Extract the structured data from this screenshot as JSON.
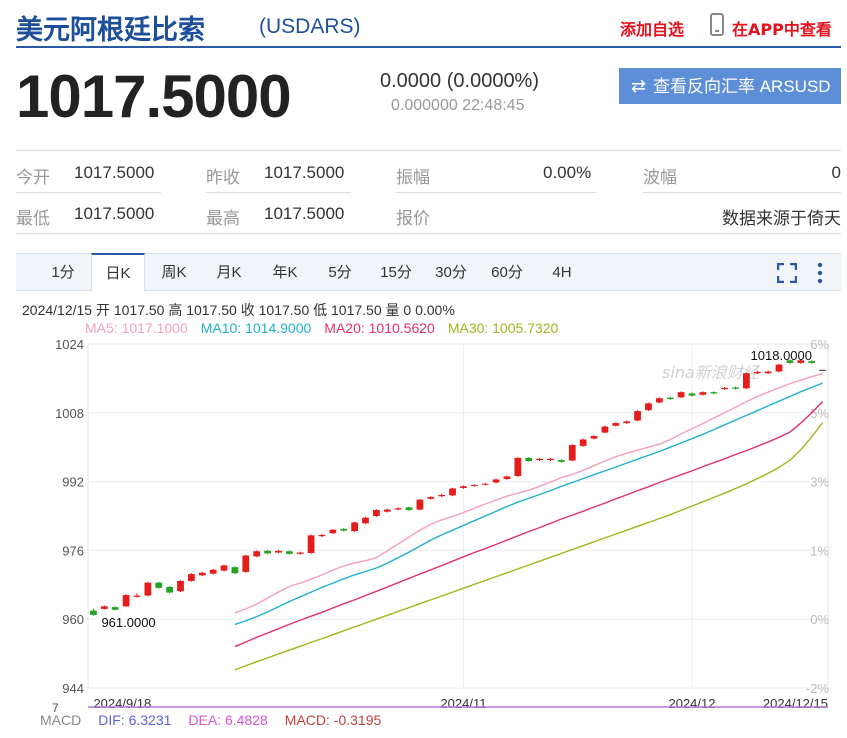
{
  "header": {
    "name": "美元阿根廷比索",
    "code": "(USDARS)",
    "add_watchlist": "添加自选",
    "view_in_app": "在APP中查看"
  },
  "quote": {
    "price": "1017.5000",
    "change": "0.0000 (0.0000%)",
    "timestamp": "0.000000 22:48:45",
    "reverse_button": "查看反向汇率 ARSUSD",
    "reverse_icon": "swap-arrows-icon"
  },
  "stats": {
    "open_label": "今开",
    "open": "1017.5000",
    "prev_close_label": "昨收",
    "prev_close": "1017.5000",
    "amplitude_label": "振幅",
    "amplitude": "0.00%",
    "wave_label": "波幅",
    "wave": "0",
    "low_label": "最低",
    "low": "1017.5000",
    "high_label": "最高",
    "high": "1017.5000",
    "quote_label": "报价",
    "source": "数据来源于倚天"
  },
  "tabs": [
    "1分",
    "日K",
    "周K",
    "月K",
    "年K",
    "5分",
    "15分",
    "30分",
    "60分",
    "4H"
  ],
  "active_tab": "日K",
  "ohlc_line": "2024/12/15 开 1017.50 高 1017.50 收 1017.50 低 1017.50 量 0 0.00%",
  "ma_line": {
    "ma5": "MA5: 1017.1000",
    "ma10": "MA10: 1014.9000",
    "ma20": "MA20: 1010.5620",
    "ma30": "MA30: 1005.7320"
  },
  "macd_line": {
    "label": "MACD",
    "dif": "DIF: 6.3231",
    "dea": "DEA: 6.4828",
    "macd": "MACD: -0.3195"
  },
  "colors": {
    "up": "#e41c1c",
    "down": "#21a321",
    "ma5": "#f4a0b8",
    "ma10": "#1fb0cf",
    "ma20": "#e4306c",
    "ma30": "#99b81c",
    "brand": "#1e4f9c",
    "accent_red": "#e4121e"
  },
  "chart_data": {
    "type": "candlestick",
    "y_ticks": [
      "1024",
      "1008",
      "992",
      "976",
      "960",
      "944"
    ],
    "ylim": [
      944,
      1024
    ],
    "pct_ticks": [
      "6%",
      "5%",
      "3%",
      "1%",
      "0%",
      "-2%"
    ],
    "x_ticks": [
      "2024/9/18",
      "2024/11",
      "2024/12",
      "2024/12/15"
    ],
    "max_label": "1018.0000",
    "min_label": "961.0000",
    "watermark": "sina新浪财经",
    "series": [
      {
        "name": "MA5",
        "values": [
          961.5,
          962.4,
          963.5,
          964.9,
          966.3,
          967.6,
          968.4,
          969.3,
          970.3,
          971.4,
          972.4,
          973.1,
          973.6,
          974.3,
          975.9,
          977.5,
          979.1,
          980.7,
          982.1,
          983.1,
          983.9,
          984.8,
          985.8,
          986.8,
          987.7,
          988.6,
          989.3,
          990.0,
          990.9,
          991.9,
          992.9,
          993.7,
          994.6,
          995.7,
          996.8,
          997.8,
          998.6,
          999.3,
          1000.0,
          1000.7,
          1001.8,
          1003.1,
          1004.3,
          1005.5,
          1006.8,
          1008.0,
          1009.3,
          1010.6,
          1011.8,
          1012.8,
          1013.8,
          1014.8,
          1015.6,
          1016.4,
          1017.1
        ]
      },
      {
        "name": "MA10",
        "values": [
          958.8,
          959.6,
          960.6,
          961.7,
          962.9,
          964.1,
          965.2,
          966.3,
          967.4,
          968.4,
          969.4,
          970.3,
          971.1,
          971.9,
          973.0,
          974.3,
          975.6,
          977.0,
          978.4,
          979.6,
          980.7,
          981.8,
          982.9,
          984.0,
          985.1,
          986.2,
          987.2,
          988.1,
          989.0,
          989.9,
          990.9,
          991.8,
          992.7,
          993.6,
          994.5,
          995.4,
          996.3,
          997.2,
          998.1,
          999.0,
          1000.0,
          1001.0,
          1002.0,
          1003.0,
          1004.1,
          1005.2,
          1006.3,
          1007.4,
          1008.5,
          1009.6,
          1010.7,
          1011.8,
          1012.9,
          1013.9,
          1014.9
        ]
      },
      {
        "name": "MA20",
        "values": [
          953.6,
          954.7,
          955.8,
          956.8,
          957.8,
          958.8,
          959.8,
          960.7,
          961.6,
          962.6,
          963.6,
          964.5,
          965.5,
          966.5,
          967.5,
          968.5,
          969.5,
          970.5,
          971.5,
          972.5,
          973.5,
          974.5,
          975.5,
          976.4,
          977.4,
          978.4,
          979.4,
          980.4,
          981.3,
          982.3,
          983.3,
          984.2,
          985.1,
          986.1,
          987.0,
          988.0,
          988.9,
          989.9,
          990.8,
          991.8,
          992.7,
          993.6,
          994.5,
          995.5,
          996.4,
          997.3,
          998.3,
          999.2,
          1000.2,
          1001.2,
          1002.3,
          1003.5,
          1005.6,
          1008.0,
          1010.6
        ]
      },
      {
        "name": "MA30",
        "values": [
          948.2,
          949.2,
          950.1,
          951.0,
          951.9,
          952.8,
          953.7,
          954.6,
          955.5,
          956.4,
          957.3,
          958.2,
          959.1,
          960.0,
          960.9,
          961.8,
          962.7,
          963.6,
          964.5,
          965.4,
          966.3,
          967.2,
          968.1,
          969.0,
          969.9,
          970.8,
          971.7,
          972.6,
          973.5,
          974.4,
          975.3,
          976.2,
          977.1,
          978.0,
          978.9,
          979.8,
          980.7,
          981.6,
          982.5,
          983.4,
          984.3,
          985.3,
          986.3,
          987.3,
          988.3,
          989.3,
          990.4,
          991.5,
          992.7,
          993.9,
          995.3,
          997.0,
          999.4,
          1002.4,
          1005.7
        ]
      }
    ],
    "candles": [
      {
        "o": 962.0,
        "c": 961.0,
        "h": 962.5,
        "l": 960.8
      },
      {
        "o": 962.4,
        "c": 963.0,
        "h": 963.2,
        "l": 962.2
      },
      {
        "o": 962.8,
        "c": 962.2,
        "h": 963.0,
        "l": 962.0
      },
      {
        "o": 963.0,
        "c": 965.6,
        "h": 965.8,
        "l": 962.8
      },
      {
        "o": 965.2,
        "c": 965.5,
        "h": 966.0,
        "l": 965.0
      },
      {
        "o": 965.5,
        "c": 968.5,
        "h": 968.7,
        "l": 965.3
      },
      {
        "o": 968.5,
        "c": 967.3,
        "h": 968.7,
        "l": 967.1
      },
      {
        "o": 967.5,
        "c": 966.2,
        "h": 967.7,
        "l": 966.0
      },
      {
        "o": 966.5,
        "c": 968.9,
        "h": 969.1,
        "l": 966.3
      },
      {
        "o": 968.9,
        "c": 970.5,
        "h": 970.7,
        "l": 968.7
      },
      {
        "o": 970.2,
        "c": 970.8,
        "h": 971.0,
        "l": 970.0
      },
      {
        "o": 970.6,
        "c": 971.5,
        "h": 971.7,
        "l": 970.4
      },
      {
        "o": 971.3,
        "c": 972.5,
        "h": 972.7,
        "l": 971.1
      },
      {
        "o": 972.1,
        "c": 970.7,
        "h": 972.3,
        "l": 970.5
      },
      {
        "o": 971.0,
        "c": 974.8,
        "h": 975.0,
        "l": 970.8
      },
      {
        "o": 974.6,
        "c": 975.8,
        "h": 976.0,
        "l": 974.4
      },
      {
        "o": 975.9,
        "c": 975.3,
        "h": 976.1,
        "l": 975.1
      },
      {
        "o": 975.5,
        "c": 975.9,
        "h": 976.1,
        "l": 975.3
      },
      {
        "o": 975.8,
        "c": 975.2,
        "h": 976.0,
        "l": 975.0
      },
      {
        "o": 975.2,
        "c": 975.5,
        "h": 975.7,
        "l": 975.0
      },
      {
        "o": 975.4,
        "c": 979.5,
        "h": 979.7,
        "l": 975.2
      },
      {
        "o": 979.3,
        "c": 979.6,
        "h": 979.8,
        "l": 979.1
      },
      {
        "o": 980.0,
        "c": 980.8,
        "h": 981.0,
        "l": 979.8
      },
      {
        "o": 981.0,
        "c": 980.6,
        "h": 981.2,
        "l": 980.4
      },
      {
        "o": 980.5,
        "c": 982.5,
        "h": 982.7,
        "l": 980.3
      },
      {
        "o": 982.3,
        "c": 983.6,
        "h": 983.8,
        "l": 982.1
      },
      {
        "o": 984.0,
        "c": 985.4,
        "h": 985.6,
        "l": 983.8
      },
      {
        "o": 985.0,
        "c": 985.5,
        "h": 985.7,
        "l": 984.8
      },
      {
        "o": 985.5,
        "c": 985.8,
        "h": 986.0,
        "l": 985.3
      },
      {
        "o": 986.0,
        "c": 985.4,
        "h": 986.2,
        "l": 985.2
      },
      {
        "o": 985.5,
        "c": 987.8,
        "h": 988.0,
        "l": 985.3
      },
      {
        "o": 988.0,
        "c": 988.4,
        "h": 988.6,
        "l": 987.8
      },
      {
        "o": 988.6,
        "c": 988.9,
        "h": 989.1,
        "l": 988.4
      },
      {
        "o": 988.8,
        "c": 990.4,
        "h": 990.6,
        "l": 988.6
      },
      {
        "o": 990.5,
        "c": 990.9,
        "h": 991.1,
        "l": 990.3
      },
      {
        "o": 991.0,
        "c": 991.2,
        "h": 991.4,
        "l": 990.8
      },
      {
        "o": 991.3,
        "c": 991.5,
        "h": 991.7,
        "l": 991.1
      },
      {
        "o": 991.8,
        "c": 992.5,
        "h": 992.7,
        "l": 991.6
      },
      {
        "o": 992.6,
        "c": 993.2,
        "h": 993.4,
        "l": 992.4
      },
      {
        "o": 993.3,
        "c": 997.5,
        "h": 997.7,
        "l": 993.1
      },
      {
        "o": 997.5,
        "c": 996.8,
        "h": 997.7,
        "l": 996.6
      },
      {
        "o": 997.0,
        "c": 997.3,
        "h": 997.5,
        "l": 996.8
      },
      {
        "o": 997.0,
        "c": 997.3,
        "h": 997.5,
        "l": 996.8
      },
      {
        "o": 997.0,
        "c": 996.6,
        "h": 997.2,
        "l": 996.4
      },
      {
        "o": 996.9,
        "c": 1000.5,
        "h": 1000.7,
        "l": 996.7
      },
      {
        "o": 1000.3,
        "c": 1001.8,
        "h": 1002.0,
        "l": 1000.1
      },
      {
        "o": 1002.0,
        "c": 1002.6,
        "h": 1002.8,
        "l": 1001.8
      },
      {
        "o": 1003.4,
        "c": 1004.8,
        "h": 1005.0,
        "l": 1003.2
      },
      {
        "o": 1005.0,
        "c": 1005.6,
        "h": 1005.8,
        "l": 1004.8
      },
      {
        "o": 1005.6,
        "c": 1006.0,
        "h": 1006.2,
        "l": 1005.4
      },
      {
        "o": 1006.2,
        "c": 1008.4,
        "h": 1008.6,
        "l": 1006.0
      },
      {
        "o": 1008.6,
        "c": 1010.2,
        "h": 1010.4,
        "l": 1008.4
      },
      {
        "o": 1010.4,
        "c": 1011.4,
        "h": 1011.6,
        "l": 1010.2
      },
      {
        "o": 1011.5,
        "c": 1011.2,
        "h": 1011.7,
        "l": 1011.0
      },
      {
        "o": 1011.6,
        "c": 1012.8,
        "h": 1013.0,
        "l": 1011.4
      },
      {
        "o": 1012.5,
        "c": 1012.0,
        "h": 1012.7,
        "l": 1011.8
      },
      {
        "o": 1012.2,
        "c": 1012.8,
        "h": 1013.0,
        "l": 1012.0
      },
      {
        "o": 1012.8,
        "c": 1012.5,
        "h": 1013.0,
        "l": 1012.3
      },
      {
        "o": 1013.5,
        "c": 1013.8,
        "h": 1014.0,
        "l": 1013.3
      },
      {
        "o": 1013.9,
        "c": 1013.6,
        "h": 1014.1,
        "l": 1013.4
      },
      {
        "o": 1013.7,
        "c": 1017.2,
        "h": 1017.4,
        "l": 1013.5
      },
      {
        "o": 1017.2,
        "c": 1017.5,
        "h": 1017.7,
        "l": 1017.0
      },
      {
        "o": 1017.2,
        "c": 1017.6,
        "h": 1017.8,
        "l": 1017.0
      },
      {
        "o": 1017.6,
        "c": 1019.2,
        "h": 1019.4,
        "l": 1017.4
      },
      {
        "o": 1020.2,
        "c": 1019.6,
        "h": 1020.4,
        "l": 1019.4
      },
      {
        "o": 1019.6,
        "c": 1020.2,
        "h": 1020.4,
        "l": 1019.4
      },
      {
        "o": 1020.0,
        "c": 1019.6,
        "h": 1020.2,
        "l": 1019.4
      },
      {
        "o": 1018.0,
        "c": 1018.0,
        "h": 1018.0,
        "l": 1018.0
      }
    ]
  }
}
